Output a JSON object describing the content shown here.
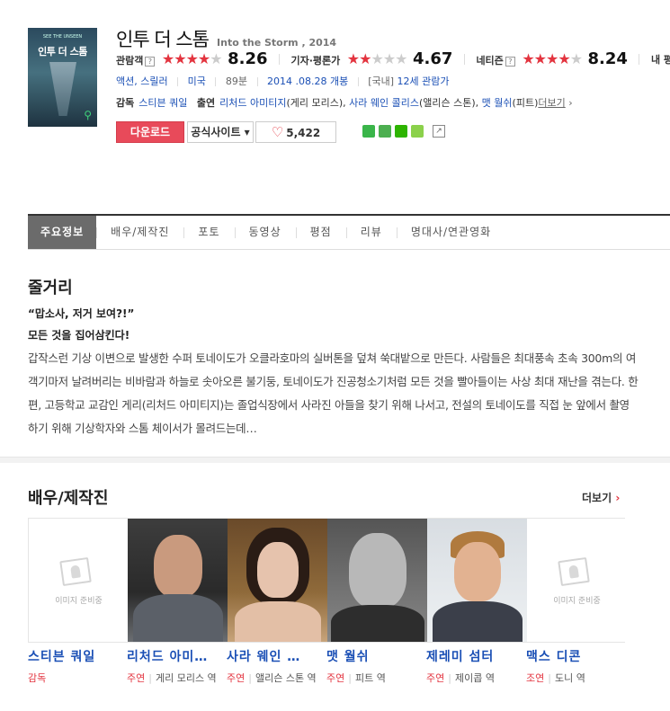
{
  "movie": {
    "poster_title": "인투 더 스톰",
    "poster_top": "SEE THE UNSEEN",
    "title_ko": "인투 더 스톰",
    "title_en": "Into the Storm , 2014"
  },
  "ratings": [
    {
      "label": "관람객",
      "stars_full": 4,
      "stars_half": 1,
      "score": "8.26"
    },
    {
      "label": "기자·평론가",
      "stars_full": 2,
      "stars_half": 1,
      "score": "4.67"
    },
    {
      "label": "네티즌",
      "stars_full": 4,
      "stars_half": 1,
      "score": "8.24"
    },
    {
      "label": "내 평"
    }
  ],
  "meta": {
    "genre1": "액션",
    "genre2": "스릴러",
    "country": "미국",
    "runtime": "89분",
    "release": "2014 .08.28 개봉",
    "grade_prefix": "[국내]",
    "grade": "12세 관람가"
  },
  "credits": {
    "director_label": "감독",
    "director": "스티븐 쿼일",
    "cast_label": "출연",
    "cast": [
      {
        "name": "리처드 아미티지",
        "role": "(게리 모리스)"
      },
      {
        "name": "사라 웨인 콜리스",
        "role": "(앨리슨 스톤)"
      },
      {
        "name": "맷 월쉬",
        "role": "(피트)"
      }
    ],
    "more": "더보기"
  },
  "buttons": {
    "download": "다운로드",
    "site": "공식사이트",
    "likes": "5,422"
  },
  "colors": {
    "accent": "#e3343f",
    "link": "#1a4fb5",
    "download_bg": "#e84a5a"
  },
  "tabs": [
    "주요정보",
    "배우/제작진",
    "포토",
    "동영상",
    "평점",
    "리뷰",
    "명대사/연관영화"
  ],
  "synopsis": {
    "heading": "줄거리",
    "tagline1": "“맙소사, 저거 보여?!”",
    "tagline2": "모든 것을 집어삼킨다!",
    "body": "갑작스런 기상 이변으로 발생한 수퍼 토네이도가 오클라호마의 실버톤을 덮쳐 쑥대밭으로 만든다. 사람들은 최대풍속 초속 300m의 여객기마저 날려버리는 비바람과 하늘로 솟아오른 불기둥, 토네이도가 진공청소기처럼 모든 것을 빨아들이는 사상 최대 재난을 겪는다. 한편, 고등학교 교감인 게리(리처드 아미티지)는 졸업식장에서 사라진 아들을 찾기 위해 나서고, 전설의 토네이도를 직접 눈 앞에서 촬영하기 위해 기상학자와 스톰 체이서가 몰려드는데…"
  },
  "cast_section": {
    "heading": "배우/제작진",
    "more": "더보기",
    "no_image": "이미지 준비중",
    "people": [
      {
        "name": "스티븐 쿼일",
        "role_type": "감독",
        "role": ""
      },
      {
        "name": "리처드 아미…",
        "role_type": "주연",
        "role": "게리 모리스 역"
      },
      {
        "name": "사라 웨인 …",
        "role_type": "주연",
        "role": "앨리슨 스톤 역"
      },
      {
        "name": "맷 월쉬",
        "role_type": "주연",
        "role": "피트 역"
      },
      {
        "name": "제레미 섬터",
        "role_type": "주연",
        "role": "제이콥 역"
      },
      {
        "name": "맥스 디콘",
        "role_type": "조연",
        "role": "도니 역"
      }
    ]
  }
}
